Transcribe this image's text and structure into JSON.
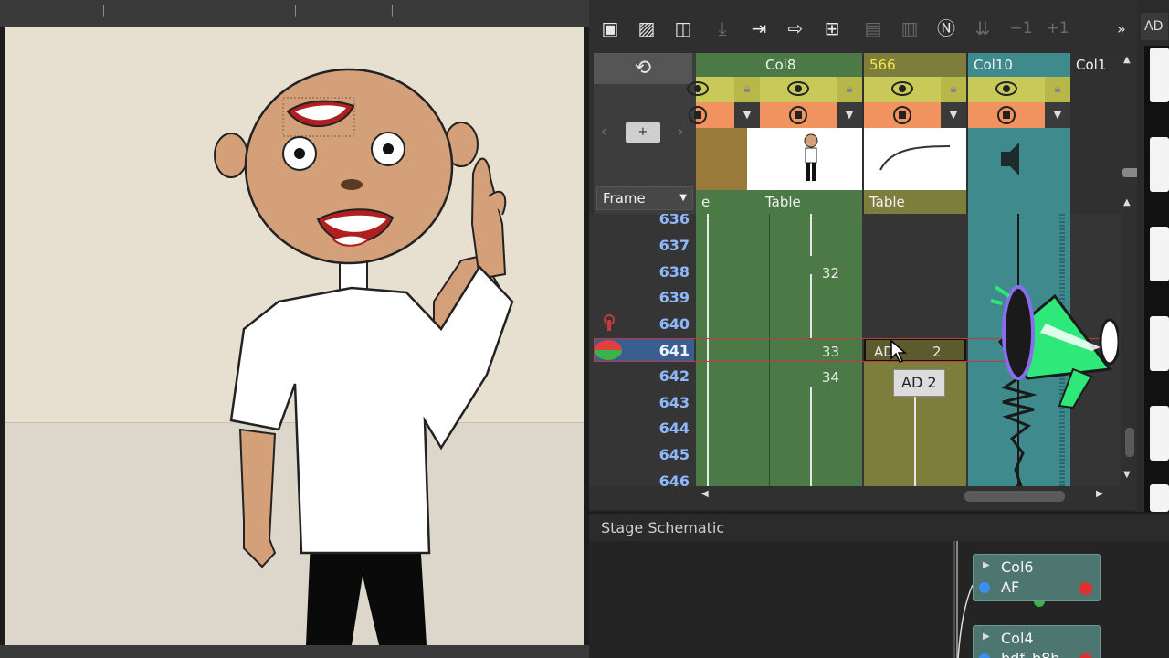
{
  "xsheet": {
    "toolbar": {
      "tools": [
        {
          "icon": "new-level-icon"
        },
        {
          "icon": "image-icon"
        },
        {
          "icon": "vector-icon"
        },
        {
          "icon": "download-icon",
          "dim": true
        },
        {
          "icon": "import-icon"
        },
        {
          "icon": "export-icon"
        },
        {
          "icon": "schematic-icon"
        },
        {
          "icon": "save-icon",
          "dim": true
        },
        {
          "icon": "save-all-icon",
          "dim": true
        },
        {
          "icon": "timer-icon"
        },
        {
          "icon": "sort-icon",
          "dim": true
        },
        {
          "label": "−1",
          "dim": true
        },
        {
          "label": "+1",
          "dim": true
        }
      ],
      "overflow": "»"
    },
    "left_panel": {
      "add_label": "+",
      "frame_select": "Frame"
    },
    "columns": [
      {
        "name": "",
        "type": "e",
        "color": "#4b7a46",
        "thumb": "wood"
      },
      {
        "name": "Col8",
        "type": "Table",
        "color": "#4b7a46",
        "thumb": "character"
      },
      {
        "name": "566",
        "type": "Table",
        "color": "#7e7e3c",
        "thumb": "curve",
        "highlight": true
      },
      {
        "name": "Col10",
        "type": "",
        "color": "#3f8a8c",
        "thumb": "speaker"
      },
      {
        "name": "Col1",
        "type": "",
        "color": "#303030"
      }
    ],
    "rows": [
      {
        "frame": "636"
      },
      {
        "frame": "637"
      },
      {
        "frame": "638",
        "col8": "32"
      },
      {
        "frame": "639"
      },
      {
        "frame": "640"
      },
      {
        "frame": "641",
        "col8": "33",
        "col566": "AD",
        "col566_num": "2",
        "current": true
      },
      {
        "frame": "642",
        "col8": "34"
      },
      {
        "frame": "643"
      },
      {
        "frame": "644"
      },
      {
        "frame": "645"
      },
      {
        "frame": "646"
      }
    ],
    "tooltip": "AD 2"
  },
  "schematic": {
    "title": "Stage Schematic",
    "nodes": [
      {
        "name": "Col6",
        "sub": "AF"
      },
      {
        "name": "Col4",
        "sub": "bdf_b8h"
      }
    ]
  },
  "right_strip": {
    "tab_label": "AD"
  }
}
